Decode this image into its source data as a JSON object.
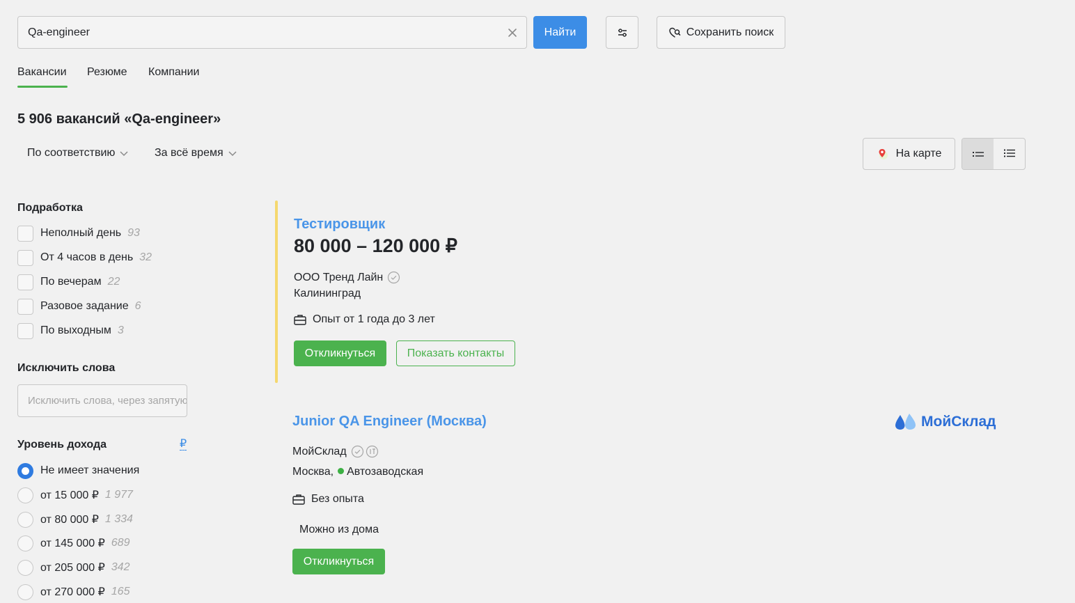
{
  "search": {
    "value": "Qa-engineer",
    "find_label": "Найти",
    "save_label": "Сохранить поиск"
  },
  "tabs": [
    {
      "label": "Вакансии",
      "active": true
    },
    {
      "label": "Резюме",
      "active": false
    },
    {
      "label": "Компании",
      "active": false
    }
  ],
  "results": {
    "title": "5 906 вакансий «Qa-engineer»",
    "sort_label": "По соответствию",
    "period_label": "За всё время",
    "map_label": "На карте"
  },
  "filters": {
    "parttime": {
      "title": "Подработка",
      "items": [
        {
          "label": "Неполный день",
          "count": "93"
        },
        {
          "label": "От 4 часов в день",
          "count": "32"
        },
        {
          "label": "По вечерам",
          "count": "22"
        },
        {
          "label": "Разовое задание",
          "count": "6"
        },
        {
          "label": "По выходным",
          "count": "3"
        }
      ]
    },
    "exclude": {
      "title": "Исключить слова",
      "placeholder": "Исключить слова, через запятую"
    },
    "income": {
      "title": "Уровень дохода",
      "currency": "₽",
      "items": [
        {
          "label": "Не имеет значения",
          "count": "",
          "checked": true
        },
        {
          "label": "от 15 000 ₽",
          "count": "1 977",
          "checked": false
        },
        {
          "label": "от 80 000 ₽",
          "count": "1 334",
          "checked": false
        },
        {
          "label": "от 145 000 ₽",
          "count": "689",
          "checked": false
        },
        {
          "label": "от 205 000 ₽",
          "count": "342",
          "checked": false
        },
        {
          "label": "от 270 000 ₽",
          "count": "165",
          "checked": false
        }
      ]
    }
  },
  "vacancies": [
    {
      "title": "Тестировщик",
      "salary": "80 000 – 120 000 ₽",
      "company": "ООО Тренд Лайн",
      "city": "Калининград",
      "experience": "Опыт от 1 года до 3 лет",
      "respond_label": "Откликнуться",
      "contacts_label": "Показать контакты"
    },
    {
      "title": "Junior QA Engineer (Москва)",
      "company": "МойСклад",
      "city": "Москва,",
      "metro": "Автозаводская",
      "experience": "Без опыта",
      "remote": "Можно из дома",
      "respond_label": "Откликнуться",
      "logo_text": "МойСклад"
    }
  ],
  "colors": {
    "primary": "#3c8de6",
    "green": "#4bb24e",
    "accent": "#f5d86f"
  }
}
